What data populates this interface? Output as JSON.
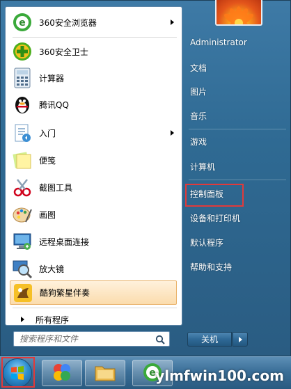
{
  "start_menu": {
    "programs": [
      {
        "label": "360安全浏览器",
        "icon": "360-browser-icon",
        "has_submenu": true
      },
      {
        "label": "360安全卫士",
        "icon": "360-security-icon",
        "has_submenu": false
      },
      {
        "label": "计算器",
        "icon": "calculator-icon",
        "has_submenu": false
      },
      {
        "label": "腾讯QQ",
        "icon": "qq-penguin-icon",
        "has_submenu": false
      },
      {
        "label": "入门",
        "icon": "getting-started-icon",
        "has_submenu": true
      },
      {
        "label": "便笺",
        "icon": "sticky-notes-icon",
        "has_submenu": false
      },
      {
        "label": "截图工具",
        "icon": "snipping-tool-icon",
        "has_submenu": false
      },
      {
        "label": "画图",
        "icon": "paint-icon",
        "has_submenu": false
      },
      {
        "label": "远程桌面连接",
        "icon": "remote-desktop-icon",
        "has_submenu": false
      },
      {
        "label": "放大镜",
        "icon": "magnifier-icon",
        "has_submenu": false
      },
      {
        "label": "酷狗繁星伴奏",
        "icon": "kugou-icon",
        "has_submenu": false,
        "highlighted": true
      }
    ],
    "all_programs_label": "所有程序",
    "search": {
      "placeholder": "搜索程序和文件"
    },
    "right_items": [
      {
        "label": "Administrator"
      },
      {
        "label": "文档"
      },
      {
        "label": "图片"
      },
      {
        "label": "音乐"
      },
      {
        "label": "游戏"
      },
      {
        "label": "计算机"
      },
      {
        "label": "控制面板",
        "highlighted": true
      },
      {
        "label": "设备和打印机"
      },
      {
        "label": "默认程序"
      },
      {
        "label": "帮助和支持"
      }
    ],
    "shutdown_label": "关机"
  },
  "taskbar": {
    "start_button": "windows-start-orb-icon",
    "pinned": [
      "pinwheel-icon",
      "explorer-folder-icon",
      "360-browser-icon"
    ]
  },
  "watermark": "ylmfwin100.com",
  "colors": {
    "highlight_border": "#e23a3a",
    "accent": "#2f6a93"
  }
}
